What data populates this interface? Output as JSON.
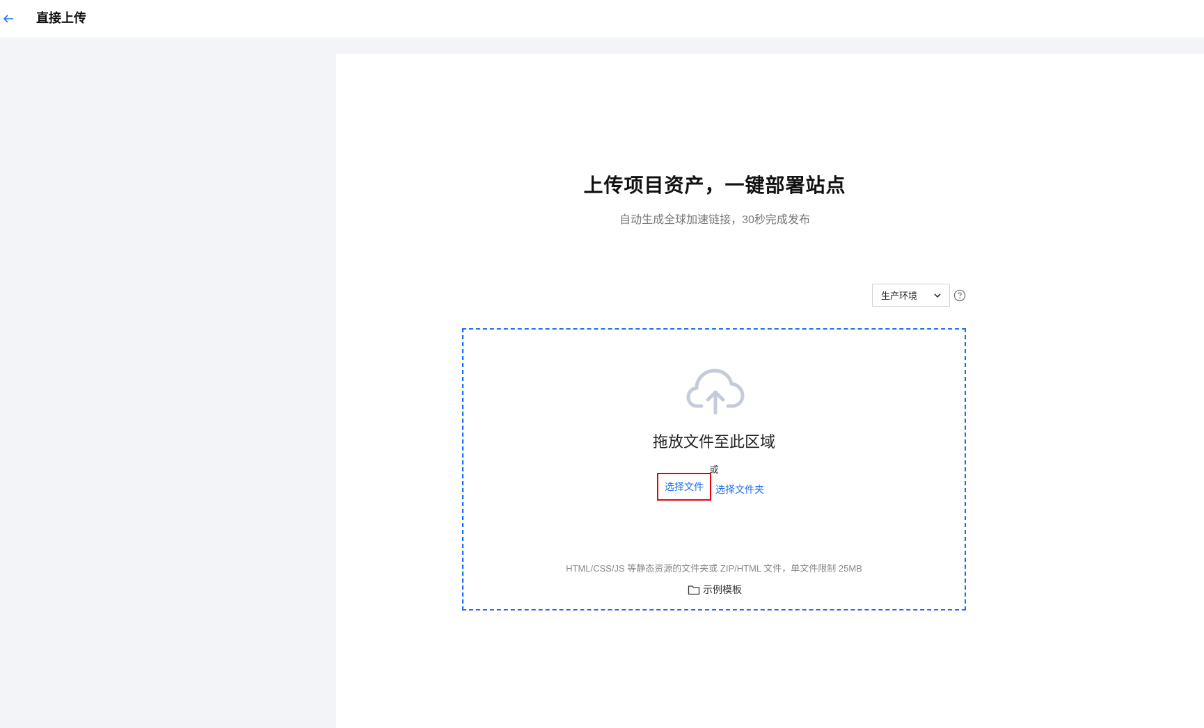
{
  "header": {
    "back_icon": "arrow-left-icon",
    "title": "直接上传"
  },
  "hero": {
    "title": "上传项目资产，一键部署站点",
    "subtitle": "自动生成全球加速链接，30秒完成发布"
  },
  "environment": {
    "selected": "生产环境",
    "help_icon": "question-circle-icon"
  },
  "upload": {
    "icon": "cloud-upload-icon",
    "drop_text": "拖放文件至此区域",
    "or_text": "或",
    "choose_file_label": "选择文件",
    "choose_folder_label": "选择文件夹",
    "hint": "HTML/CSS/JS 等静态资源的文件夹或 ZIP/HTML 文件，单文件限制 25MB",
    "template_icon": "folder-icon",
    "template_label": "示例模板"
  },
  "colors": {
    "accent": "#1c6ef2",
    "highlight": "#e60012",
    "background": "#f3f4f7"
  }
}
